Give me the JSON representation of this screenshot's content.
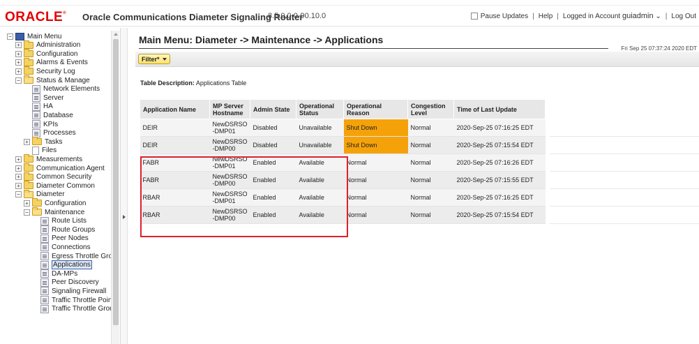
{
  "header": {
    "logo_text": "ORACLE",
    "logo_mark": "®",
    "app_title": "Oracle Communications Diameter Signaling Router",
    "version": "8.5.0.0.0-90.10.0",
    "pause_updates": "Pause Updates",
    "help": "Help",
    "logged_in_prefix": "Logged in Account",
    "account": "guiadmin",
    "account_caret": "⌄",
    "logout": "Log Out",
    "separator": "|"
  },
  "sidebar": {
    "items": [
      {
        "label": "Main Menu",
        "type": "root",
        "expander": "−"
      },
      {
        "label": "Administration",
        "type": "folder",
        "expander": "+"
      },
      {
        "label": "Configuration",
        "type": "folder",
        "expander": "+"
      },
      {
        "label": "Alarms & Events",
        "type": "folder",
        "expander": "+"
      },
      {
        "label": "Security Log",
        "type": "folder",
        "expander": "+"
      },
      {
        "label": "Status & Manage",
        "type": "folder-open",
        "expander": "−"
      },
      {
        "label": "Network Elements",
        "type": "page"
      },
      {
        "label": "Server",
        "type": "page"
      },
      {
        "label": "HA",
        "type": "page"
      },
      {
        "label": "Database",
        "type": "page"
      },
      {
        "label": "KPIs",
        "type": "page"
      },
      {
        "label": "Processes",
        "type": "page"
      },
      {
        "label": "Tasks",
        "type": "folder",
        "expander": "+"
      },
      {
        "label": "Files",
        "type": "file"
      },
      {
        "label": "Measurements",
        "type": "folder",
        "expander": "+"
      },
      {
        "label": "Communication Agent",
        "type": "folder",
        "expander": "+"
      },
      {
        "label": "Common Security",
        "type": "folder",
        "expander": "+"
      },
      {
        "label": "Diameter Common",
        "type": "folder",
        "expander": "+"
      },
      {
        "label": "Diameter",
        "type": "folder-open",
        "expander": "−"
      },
      {
        "label": "Configuration",
        "type": "folder",
        "expander": "+"
      },
      {
        "label": "Maintenance",
        "type": "folder-open",
        "expander": "−"
      },
      {
        "label": "Route Lists",
        "type": "page"
      },
      {
        "label": "Route Groups",
        "type": "page"
      },
      {
        "label": "Peer Nodes",
        "type": "page"
      },
      {
        "label": "Connections",
        "type": "page"
      },
      {
        "label": "Egress Throttle Gro",
        "type": "page"
      },
      {
        "label": "Applications",
        "type": "page",
        "selected": true
      },
      {
        "label": "DA-MPs",
        "type": "page"
      },
      {
        "label": "Peer Discovery",
        "type": "page"
      },
      {
        "label": "Signaling Firewall",
        "type": "page"
      },
      {
        "label": "Traffic Throttle Poin",
        "type": "page"
      },
      {
        "label": "Traffic Throttle Grou",
        "type": "page"
      }
    ]
  },
  "main": {
    "title": "Main Menu: Diameter -> Maintenance -> Applications",
    "datetime": "Fri Sep 25 07:37:24 2020 EDT",
    "filter_label": "Filter*",
    "table_desc_label": "Table Description:",
    "table_desc_value": "Applications Table",
    "columns": [
      "Application Name",
      "MP Server Hostname",
      "Admin State",
      "Operational Status",
      "Operational Reason",
      "Congestion Level",
      "Time of Last Update"
    ],
    "rows": [
      {
        "app": "DEIR",
        "host": "NewDSRSO -DMP01",
        "admin": "Disabled",
        "op_status": "Unavailable",
        "op_reason": "Shut Down",
        "congestion": "Normal",
        "updated": "2020-Sep-25 07:16:25 EDT",
        "warn": true
      },
      {
        "app": "DEIR",
        "host": "NewDSRSO -DMP00",
        "admin": "Disabled",
        "op_status": "Unavailable",
        "op_reason": "Shut Down",
        "congestion": "Normal",
        "updated": "2020-Sep-25 07:15:54 EDT",
        "warn": true
      },
      {
        "app": "FABR",
        "host": "NewDSRSO -DMP01",
        "admin": "Enabled",
        "op_status": "Available",
        "op_reason": "Normal",
        "congestion": "Normal",
        "updated": "2020-Sep-25 07:16:26 EDT",
        "warn": false
      },
      {
        "app": "FABR",
        "host": "NewDSRSO -DMP00",
        "admin": "Enabled",
        "op_status": "Available",
        "op_reason": "Normal",
        "congestion": "Normal",
        "updated": "2020-Sep-25 07:15:55 EDT",
        "warn": false
      },
      {
        "app": "RBAR",
        "host": "NewDSRSO -DMP01",
        "admin": "Enabled",
        "op_status": "Available",
        "op_reason": "Normal",
        "congestion": "Normal",
        "updated": "2020-Sep-25 07:16:25 EDT",
        "warn": false
      },
      {
        "app": "RBAR",
        "host": "NewDSRSO -DMP00",
        "admin": "Enabled",
        "op_status": "Available",
        "op_reason": "Normal",
        "congestion": "Normal",
        "updated": "2020-Sep-25 07:15:54 EDT",
        "warn": false
      }
    ]
  },
  "colors": {
    "oracle_red": "#e30000",
    "shutdown_orange": "#f5a20a",
    "highlight_red": "#e0202a",
    "filter_yellow": "#ffe26b"
  }
}
